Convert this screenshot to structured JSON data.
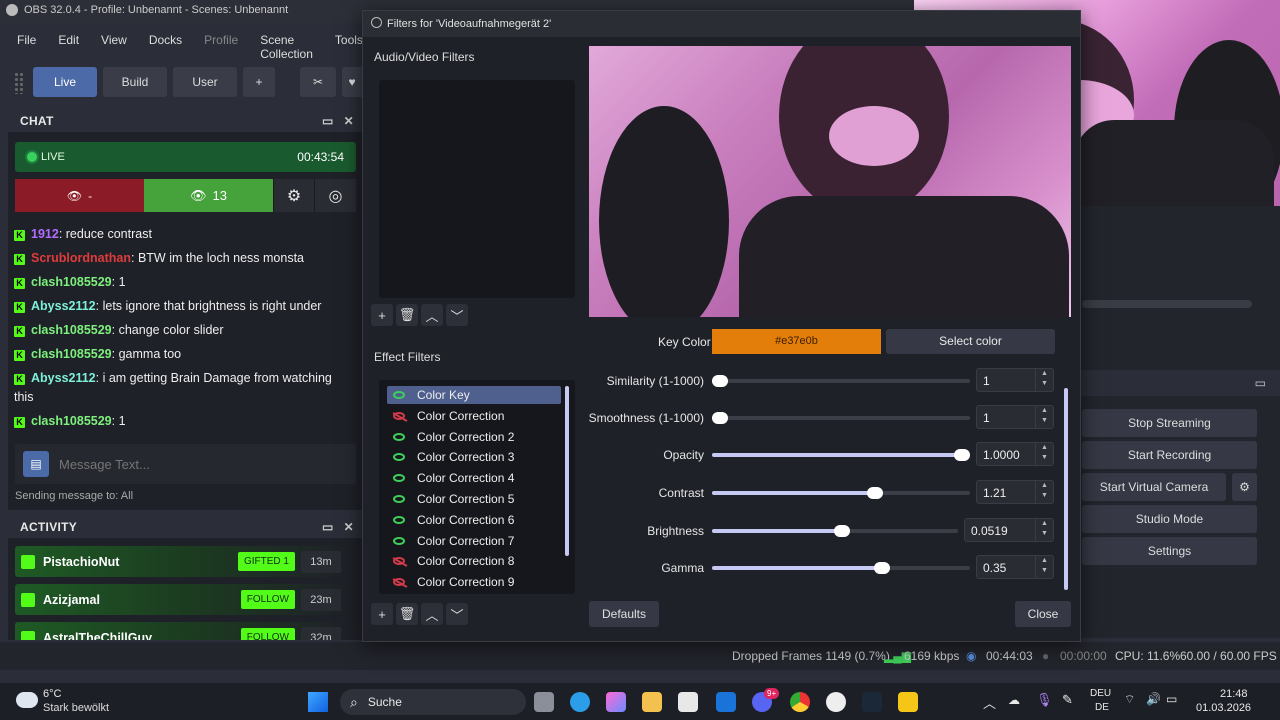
{
  "window": {
    "title": "OBS 32.0.4 - Profile: Unbenannt - Scenes: Unbenannt"
  },
  "menu": [
    "File",
    "Edit",
    "View",
    "Docks",
    "Profile",
    "Scene Collection",
    "Tools"
  ],
  "toolbar": {
    "live": "Live",
    "build": "Build",
    "user": "User",
    "add": "+"
  },
  "chat": {
    "title": "CHAT",
    "live_label": "LIVE",
    "live_time": "00:43:54",
    "viewers_left": "-",
    "viewers_right": "13",
    "messages": [
      {
        "user": "1912",
        "color": "#b36cff",
        "text": ": reduce contrast"
      },
      {
        "user": "Scrublordnathan",
        "color": "#e03b3b",
        "text": ": BTW im the loch ness monsta"
      },
      {
        "user": "clash1085529",
        "color": "#7df07d",
        "text": ": 1"
      },
      {
        "user": "Abyss2112",
        "color": "#7df0d8",
        "text": ": lets ignore that brightness is right under"
      },
      {
        "user": "clash1085529",
        "color": "#7df07d",
        "text": ": change color slider"
      },
      {
        "user": "clash1085529",
        "color": "#7df07d",
        "text": ": gamma too"
      },
      {
        "user": "Abyss2112",
        "color": "#7df0d8",
        "text": ": i am getting Brain Damage from watching this"
      },
      {
        "user": "clash1085529",
        "color": "#7df07d",
        "text": ": 1"
      }
    ],
    "input_placeholder": "Message Text...",
    "sending_to": "Sending message to: All"
  },
  "activity": {
    "title": "ACTIVITY",
    "items": [
      {
        "name": "PistachioNut",
        "badge": "GIFTED 1",
        "time": "13m"
      },
      {
        "name": "Azizjamal",
        "badge": "FOLLOW",
        "time": "23m"
      },
      {
        "name": "AstralTheChillGuy",
        "badge": "FOLLOW",
        "time": "32m"
      }
    ]
  },
  "filters_dialog": {
    "title": "Filters for 'Videoaufnahmegerät 2'",
    "av_filters_label": "Audio/Video Filters",
    "effect_filters_label": "Effect Filters",
    "effect_filters": [
      {
        "name": "Color Key",
        "visible": true,
        "selected": true
      },
      {
        "name": "Color Correction",
        "visible": false
      },
      {
        "name": "Color Correction 2",
        "visible": true
      },
      {
        "name": "Color Correction 3",
        "visible": true
      },
      {
        "name": "Color Correction 4",
        "visible": true
      },
      {
        "name": "Color Correction 5",
        "visible": true
      },
      {
        "name": "Color Correction 6",
        "visible": true
      },
      {
        "name": "Color Correction 7",
        "visible": true
      },
      {
        "name": "Color Correction 8",
        "visible": false
      },
      {
        "name": "Color Correction 9",
        "visible": false
      }
    ],
    "key_color_label": "Key Color",
    "key_color_value": "#e37e0b",
    "select_color": "Select color",
    "props": [
      {
        "label": "Similarity (1-1000)",
        "value": "1",
        "fraction": 0.0
      },
      {
        "label": "Smoothness (1-1000)",
        "value": "1",
        "fraction": 0.0
      },
      {
        "label": "Opacity",
        "value": "1.0000",
        "fraction": 1.0
      },
      {
        "label": "Contrast",
        "value": "1.21",
        "fraction": 0.64
      },
      {
        "label": "Brightness",
        "value": "0.0519",
        "fraction": 0.53
      },
      {
        "label": "Gamma",
        "value": "0.35",
        "fraction": 0.67
      }
    ],
    "defaults": "Defaults",
    "close": "Close"
  },
  "controls": [
    "Stop Streaming",
    "Start Recording",
    "Start Virtual Camera",
    "Studio Mode",
    "Settings"
  ],
  "status": {
    "dropped": "Dropped Frames 1149 (0.7%)",
    "kbps": "6169 kbps",
    "stream_time": "00:44:03",
    "rec_time": "00:00:00",
    "cpu": "CPU: 11.6%",
    "fps": "60.00 / 60.00 FPS"
  },
  "taskbar": {
    "weather_temp": "6°C",
    "weather_desc": "Stark bewölkt",
    "search": "Suche",
    "lang1": "DEU",
    "lang2": "DE",
    "time": "21:48",
    "date": "01.03.2026",
    "badge": "9+"
  },
  "colors": {
    "accent": "#53fc18",
    "selected": "#4f5f8e",
    "key": "#e37e0b"
  }
}
